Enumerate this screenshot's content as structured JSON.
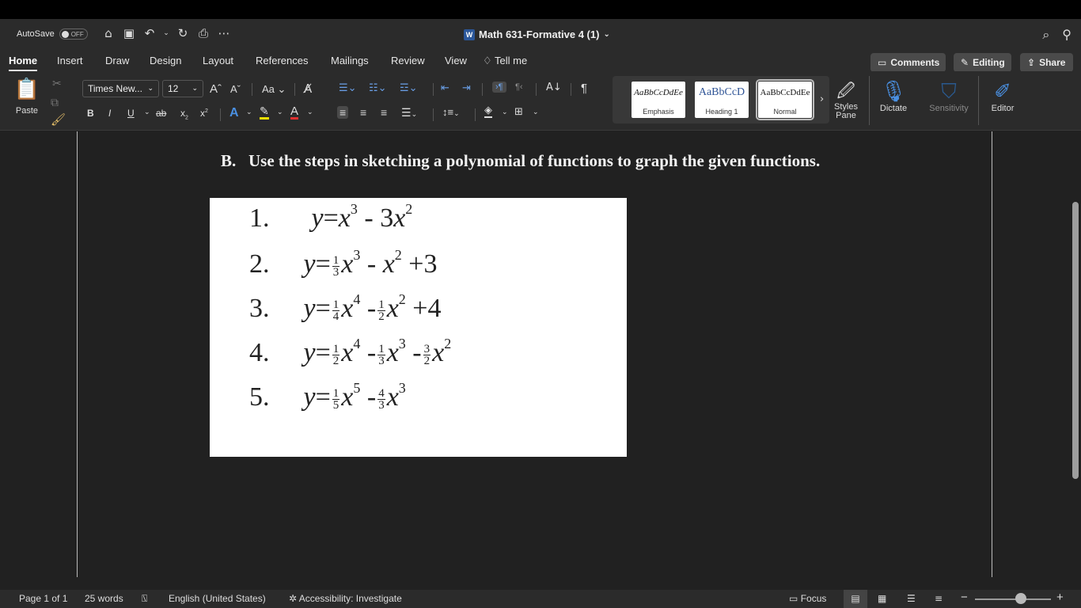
{
  "titlebar": {
    "autosave_label": "AutoSave",
    "autosave_state": "OFF",
    "document_title": "Math 631-Formative 4 (1)"
  },
  "tabs": [
    {
      "label": "Home",
      "active": true
    },
    {
      "label": "Insert"
    },
    {
      "label": "Draw"
    },
    {
      "label": "Design"
    },
    {
      "label": "Layout"
    },
    {
      "label": "References"
    },
    {
      "label": "Mailings"
    },
    {
      "label": "Review"
    },
    {
      "label": "View"
    },
    {
      "label": "Tell me"
    }
  ],
  "ribbon_buttons": {
    "comments": "Comments",
    "editing": "Editing",
    "share": "Share"
  },
  "ribbon": {
    "paste_label": "Paste",
    "font_name": "Times New...",
    "font_size": "12",
    "change_case": "Aa",
    "bold": "B",
    "italic": "I",
    "underline": "U",
    "strikethrough": "ab",
    "subscript": "x",
    "superscript": "x",
    "styles": [
      {
        "sample": "AaBbCcDdEe",
        "name": "Emphasis"
      },
      {
        "sample": "AaBbCcD",
        "name": "Heading 1"
      },
      {
        "sample": "AaBbCcDdEe",
        "name": "Normal",
        "selected": true
      }
    ],
    "styles_pane": "Styles\nPane",
    "dictate": "Dictate",
    "sensitivity": "Sensitivity",
    "editor": "Editor"
  },
  "document": {
    "heading_number": "B.",
    "heading_text": "Use the steps in sketching a polynomial of functions to graph the given functions.",
    "equations": [
      {
        "n": "1.",
        "parts": "y = x³ - 3x²"
      },
      {
        "n": "2.",
        "parts": "y = ⅓x³ - x² + 3"
      },
      {
        "n": "3.",
        "parts": "y = ¼x⁴ - ½x² + 4"
      },
      {
        "n": "4.",
        "parts": "y = ½x⁴ - ⅓x³ - 3/2 x²"
      },
      {
        "n": "5.",
        "parts": "y = ⅕x⁵ - 4/3 x³"
      }
    ]
  },
  "statusbar": {
    "page": "Page 1 of 1",
    "words": "25 words",
    "language": "English (United States)",
    "accessibility": "Accessibility: Investigate",
    "focus": "Focus"
  }
}
